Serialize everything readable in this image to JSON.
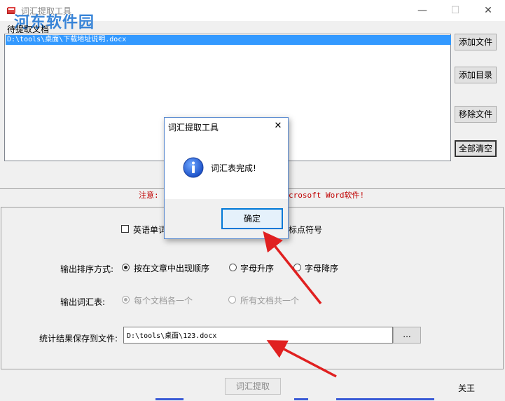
{
  "window": {
    "title": "词汇提取工具",
    "watermark": "河东软件园",
    "min_glyph": "—",
    "max_glyph": "☐",
    "close_glyph": "✕"
  },
  "file_list": {
    "label": "待提取文档",
    "rows": [
      "D:\\tools\\桌面\\下载地址说明.docx"
    ]
  },
  "side_buttons": {
    "add_file": "添加文件",
    "add_dir": "添加目录",
    "remove_file": "移除文件",
    "clear_all": "全部清空"
  },
  "notice": {
    "prefix": "注意:",
    "suffix": "crosoft Word软件!"
  },
  "options": {
    "english_words_label": "英语单词",
    "punct_label": "标点符号",
    "sort_label": "输出排序方式:",
    "sort_options": [
      "按在文章中出现顺序",
      "字母升序",
      "字母降序"
    ],
    "sort_selected": "按在文章中出现顺序",
    "output_label": "输出词汇表:",
    "output_options": [
      "每个文档各一个",
      "所有文档共一个"
    ],
    "save_label": "统计结果保存到文件:",
    "save_path": "D:\\tools\\桌面\\123.docx",
    "browse_label": "...",
    "extract_label": "词汇提取",
    "close_label": "关王"
  },
  "dialog": {
    "title": "词汇提取工具",
    "close_glyph": "✕",
    "message": "词汇表完成!",
    "ok_label": "确定"
  },
  "colors": {
    "selection": "#3399ff",
    "notice": "#c00000",
    "arrow": "#e02020",
    "watermark": "#2f7fd6",
    "focus": "#0078d7"
  }
}
